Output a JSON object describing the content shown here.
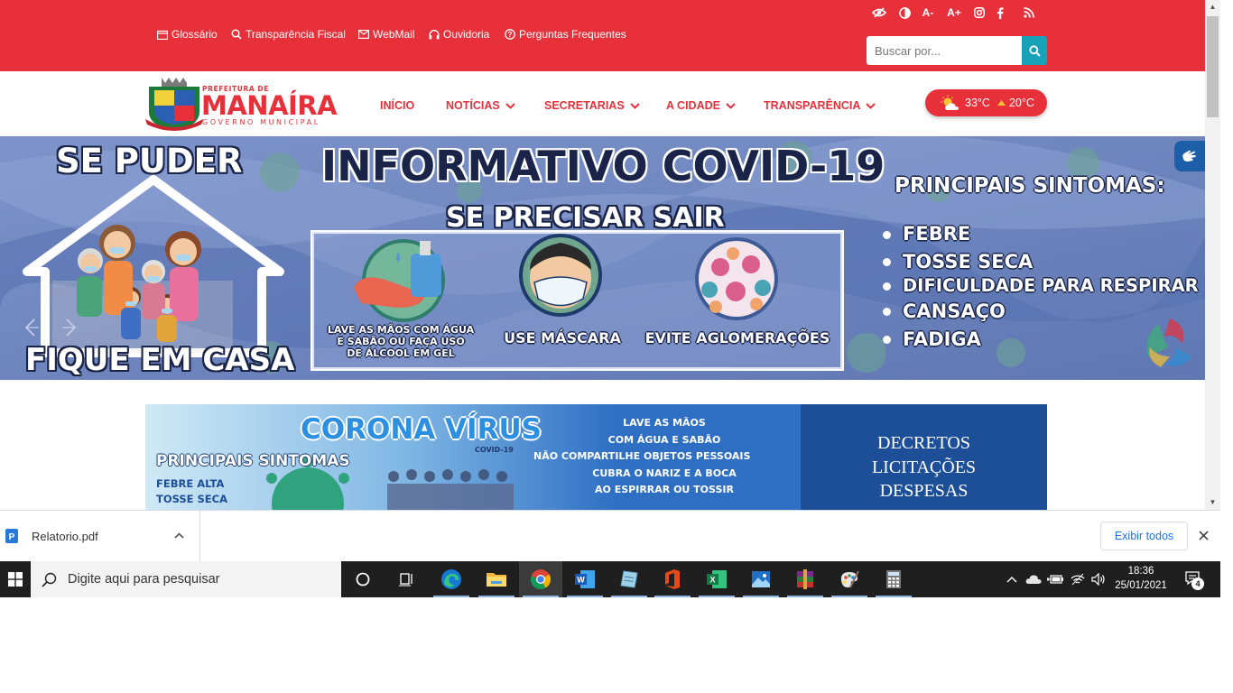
{
  "topbar": {
    "links": [
      {
        "label": "Glossário",
        "icon": "calendar-icon"
      },
      {
        "label": "Transparência Fiscal",
        "icon": "search-icon"
      },
      {
        "label": "WebMail",
        "icon": "envelope-icon"
      },
      {
        "label": "Ouvidoria",
        "icon": "headphones-icon"
      },
      {
        "label": "Perguntas Frequentes",
        "icon": "question-circle-icon"
      }
    ],
    "accessibility": {
      "font_decrease": "A-",
      "font_increase": "A+"
    },
    "search": {
      "placeholder": "Buscar por..."
    }
  },
  "logo": {
    "line1": "PREFEITURA DE",
    "line2": "MANAÍRA",
    "line3": "GOVERNO MUNICIPAL"
  },
  "nav": {
    "items": [
      {
        "label": "INÍCIO",
        "dropdown": false
      },
      {
        "label": "NOTÍCIAS",
        "dropdown": true
      },
      {
        "label": "SECRETARIAS",
        "dropdown": true
      },
      {
        "label": "A CIDADE",
        "dropdown": true
      },
      {
        "label": "TRANSPARÊNCIA",
        "dropdown": true
      }
    ]
  },
  "weather": {
    "max": "33°C",
    "min": "20°C"
  },
  "hero": {
    "left_top": "SE PUDER",
    "left_bottom": "FIQUE EM CASA",
    "title": "INFORMATIVO COVID-19",
    "subtitle": "SE PRECISAR SAIR",
    "panels": [
      {
        "caption1": "LAVE AS MÃOS COM ÁGUA",
        "caption2": "E SABÃO OU FAÇA USO",
        "caption3": "DE ÁLCOOL EM GEL"
      },
      {
        "caption1": "USE MÁSCARA"
      },
      {
        "caption1": "EVITE AGLOMERAÇÕES"
      }
    ],
    "symptoms_title": "PRINCIPAIS SINTOMAS:",
    "symptoms": [
      "FEBRE",
      "TOSSE SECA",
      "DIFICULDADE PARA RESPIRAR",
      "CANSAÇO",
      "FADIGA"
    ]
  },
  "banner2": {
    "title": "CORONA VÍRUS",
    "title_sub": "COVID-19",
    "symptoms_title": "PRINCIPAIS SINTOMAS",
    "symptoms": [
      "FEBRE ALTA",
      "TOSSE SECA"
    ],
    "tips": [
      "LAVE AS MÃOS",
      "COM ÁGUA E SABÃO",
      "NÃO COMPARTILHE OBJETOS PESSOAIS",
      "CUBRA O NARIZ E A BOCA",
      "AO ESPIRRAR OU TOSSIR"
    ],
    "right_links": [
      "DECRETOS",
      "LICITAÇÕES",
      "DESPESAS"
    ]
  },
  "downloads": {
    "file_name": "Relatorio.pdf",
    "show_all": "Exibir todos"
  },
  "taskbar": {
    "search_placeholder": "Digite aqui para pesquisar",
    "apps": [
      "cortana-icon",
      "task-view-icon",
      "edge-icon",
      "file-explorer-icon",
      "chrome-icon",
      "word-icon",
      "notes-icon",
      "office-icon",
      "excel-icon",
      "photos-icon",
      "winrar-icon",
      "paint-icon",
      "calculator-icon"
    ],
    "time": "18:36",
    "date": "25/01/2021",
    "notifications": "4"
  },
  "colors": {
    "brand_red": "#e8303a",
    "search_button": "#17a2b8",
    "hero_bg": "#6f86c0",
    "taskbar": "#1f1f1f"
  }
}
